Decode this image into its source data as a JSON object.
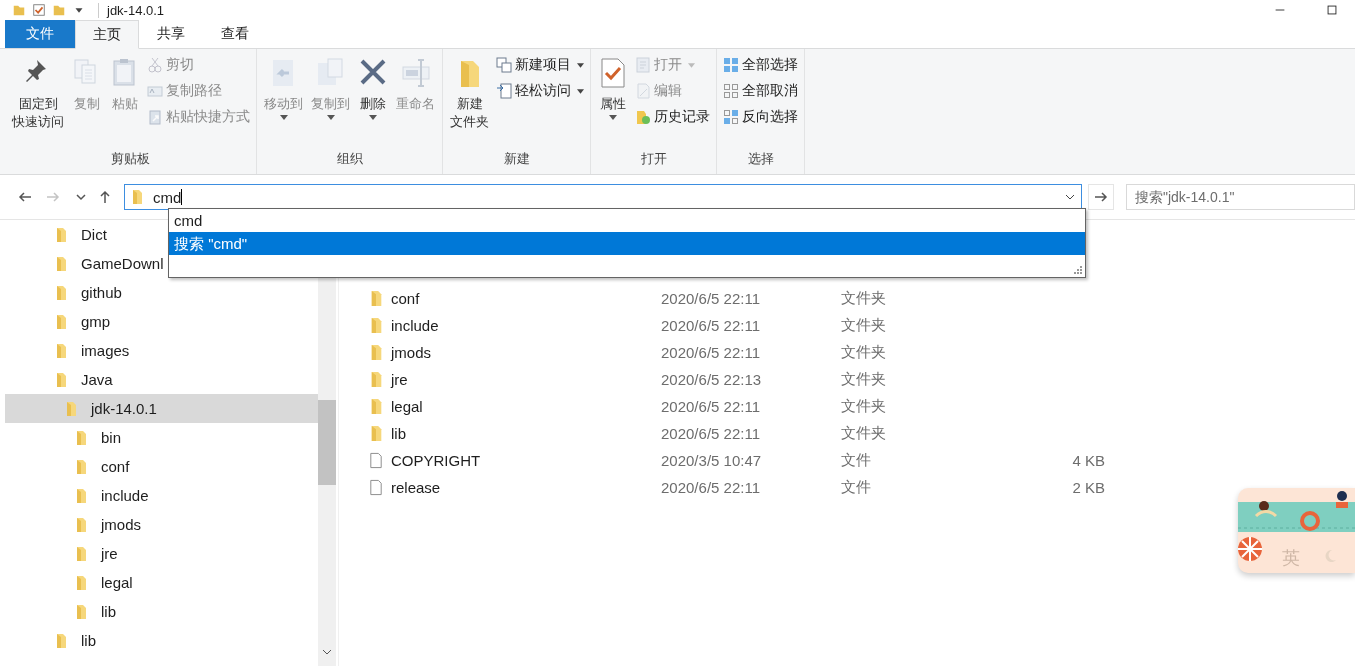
{
  "window": {
    "title": "jdk-14.0.1"
  },
  "ribbon_tabs": [
    {
      "label": "文件",
      "kind": "file",
      "selected": false
    },
    {
      "label": "主页",
      "kind": "tab",
      "selected": true
    },
    {
      "label": "共享",
      "kind": "tab",
      "selected": false
    },
    {
      "label": "查看",
      "kind": "tab",
      "selected": false
    }
  ],
  "ribbon_groups": [
    {
      "label": "剪贴板",
      "large": [
        {
          "lines": [
            "固定到",
            "快速访问"
          ],
          "disabled": false,
          "dropdown": false
        },
        {
          "label": "复制",
          "disabled": true,
          "dropdown": false
        },
        {
          "label": "粘贴",
          "disabled": true,
          "dropdown": false
        }
      ],
      "small": [
        {
          "label": "剪切",
          "disabled": true,
          "dropdown": false
        },
        {
          "label": "复制路径",
          "disabled": true,
          "dropdown": false
        },
        {
          "label": "粘贴快捷方式",
          "disabled": true,
          "dropdown": false
        }
      ]
    },
    {
      "label": "组织",
      "large": [
        {
          "label": "移动到",
          "disabled": true,
          "dropdown": true
        },
        {
          "label": "复制到",
          "disabled": true,
          "dropdown": true
        },
        {
          "label": "删除",
          "disabled": false,
          "dropdown": true
        },
        {
          "label": "重命名",
          "disabled": true,
          "dropdown": false
        }
      ]
    },
    {
      "label": "新建",
      "large": [
        {
          "lines": [
            "新建",
            "文件夹"
          ],
          "disabled": false,
          "dropdown": false
        }
      ],
      "small": [
        {
          "label": "新建项目",
          "disabled": false,
          "dropdown": true
        },
        {
          "label": "轻松访问",
          "disabled": false,
          "dropdown": true
        }
      ]
    },
    {
      "label": "打开",
      "large": [
        {
          "label": "属性",
          "disabled": false,
          "dropdown": true
        }
      ],
      "small": [
        {
          "label": "打开",
          "disabled": true,
          "dropdown": true
        },
        {
          "label": "编辑",
          "disabled": true,
          "dropdown": false
        },
        {
          "label": "历史记录",
          "disabled": false,
          "dropdown": false
        }
      ]
    },
    {
      "label": "选择",
      "small": [
        {
          "label": "全部选择",
          "disabled": false,
          "dropdown": false
        },
        {
          "label": "全部取消",
          "disabled": false,
          "dropdown": false
        },
        {
          "label": "反向选择",
          "disabled": false,
          "dropdown": false
        }
      ]
    }
  ],
  "nav_buttons": [
    {
      "kind": "back",
      "disabled": false
    },
    {
      "kind": "forward",
      "disabled": true
    },
    {
      "kind": "recent",
      "disabled": false
    },
    {
      "kind": "up",
      "disabled": false
    }
  ],
  "address_bar": {
    "value": "cmd"
  },
  "address_suggestions": [
    {
      "text": "cmd",
      "selected": false
    },
    {
      "text": "搜索 \"cmd\"",
      "selected": true
    }
  ],
  "search": {
    "placeholder": "搜索\"jdk-14.0.1\""
  },
  "tree": [
    {
      "label": "Dict",
      "selected": false
    },
    {
      "label": "GameDownl",
      "selected": false
    },
    {
      "label": "github",
      "selected": false
    },
    {
      "label": "gmp",
      "selected": false
    },
    {
      "label": "images",
      "selected": false
    },
    {
      "label": "Java",
      "selected": false,
      "children": [
        {
          "label": "jdk-14.0.1",
          "selected": true,
          "children": [
            {
              "label": "bin",
              "selected": false
            },
            {
              "label": "conf",
              "selected": false
            },
            {
              "label": "include",
              "selected": false
            },
            {
              "label": "jmods",
              "selected": false
            },
            {
              "label": "jre",
              "selected": false
            },
            {
              "label": "legal",
              "selected": false
            },
            {
              "label": "lib",
              "selected": false
            }
          ]
        }
      ]
    },
    {
      "label": "lib",
      "selected": false
    }
  ],
  "files": [
    {
      "kind": "folder",
      "name": "conf",
      "date": "2020/6/5 22:11",
      "type": "文件夹"
    },
    {
      "kind": "folder",
      "name": "include",
      "date": "2020/6/5 22:11",
      "type": "文件夹"
    },
    {
      "kind": "folder",
      "name": "jmods",
      "date": "2020/6/5 22:11",
      "type": "文件夹"
    },
    {
      "kind": "folder",
      "name": "jre",
      "date": "2020/6/5 22:13",
      "type": "文件夹"
    },
    {
      "kind": "folder",
      "name": "legal",
      "date": "2020/6/5 22:11",
      "type": "文件夹"
    },
    {
      "kind": "folder",
      "name": "lib",
      "date": "2020/6/5 22:11",
      "type": "文件夹"
    },
    {
      "kind": "file",
      "name": "COPYRIGHT",
      "date": "2020/3/5 10:47",
      "type": "文件",
      "size": "4 KB"
    },
    {
      "kind": "file",
      "name": "release",
      "date": "2020/6/5 22:11",
      "type": "文件",
      "size": "2 KB"
    }
  ],
  "ime_widget": {
    "mode": "英"
  }
}
